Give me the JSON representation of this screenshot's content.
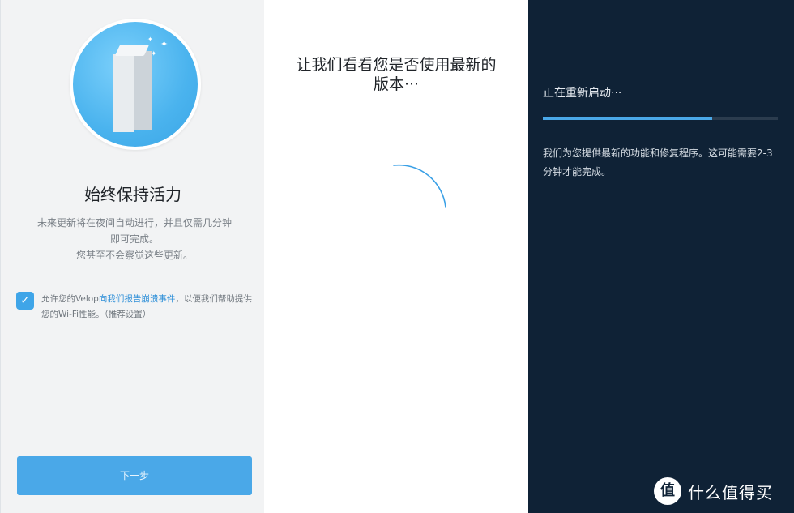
{
  "left": {
    "title": "始终保持活力",
    "desc_line1": "未来更新将在夜间自动进行，并且仅需几分钟",
    "desc_line2": "即可完成。",
    "desc_line3": "您甚至不会察觉这些更新。",
    "consent_prefix": "允许您的Velop",
    "consent_link": "向我们报告崩溃事件",
    "consent_suffix": "，以便我们帮助提供您的Wi-Fi性能。（推荐设置）",
    "checkbox_checked": true,
    "next_label": "下一步"
  },
  "middle": {
    "title_line1": "让我们看看您是否使用最新的",
    "title_line2": "版本···"
  },
  "right": {
    "title": "正在重新启动···",
    "progress": 0.72,
    "desc": "我们为您提供最新的功能和修复程序。这可能需要2-3分钟才能完成。"
  },
  "watermark": {
    "logo_glyph": "值",
    "text": "什么值得买"
  },
  "colors": {
    "accent": "#4aa8e8",
    "dark_panel": "#0f2236"
  }
}
